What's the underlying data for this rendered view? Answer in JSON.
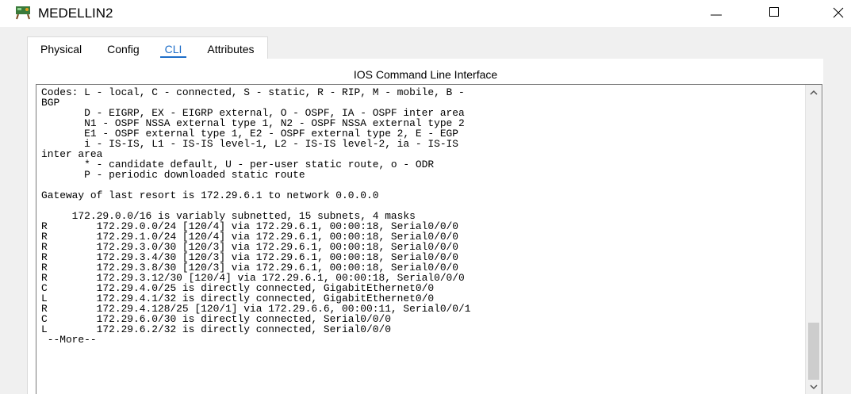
{
  "window": {
    "title": "MEDELLIN2",
    "icon": "router-device-icon",
    "controls": [
      "minimize-icon",
      "maximize-icon",
      "close-icon"
    ]
  },
  "tabs": [
    {
      "label": "Physical",
      "active": false
    },
    {
      "label": "Config",
      "active": false
    },
    {
      "label": "CLI",
      "active": true
    },
    {
      "label": "Attributes",
      "active": false
    }
  ],
  "panel": {
    "title": "IOS Command Line Interface"
  },
  "terminal": {
    "lines": [
      "Codes: L - local, C - connected, S - static, R - RIP, M - mobile, B -",
      "BGP",
      "       D - EIGRP, EX - EIGRP external, O - OSPF, IA - OSPF inter area",
      "       N1 - OSPF NSSA external type 1, N2 - OSPF NSSA external type 2",
      "       E1 - OSPF external type 1, E2 - OSPF external type 2, E - EGP",
      "       i - IS-IS, L1 - IS-IS level-1, L2 - IS-IS level-2, ia - IS-IS",
      "inter area",
      "       * - candidate default, U - per-user static route, o - ODR",
      "       P - periodic downloaded static route",
      "",
      "Gateway of last resort is 172.29.6.1 to network 0.0.0.0",
      "",
      "     172.29.0.0/16 is variably subnetted, 15 subnets, 4 masks",
      "R        172.29.0.0/24 [120/4] via 172.29.6.1, 00:00:18, Serial0/0/0",
      "R        172.29.1.0/24 [120/4] via 172.29.6.1, 00:00:18, Serial0/0/0",
      "R        172.29.3.0/30 [120/3] via 172.29.6.1, 00:00:18, Serial0/0/0",
      "R        172.29.3.4/30 [120/3] via 172.29.6.1, 00:00:18, Serial0/0/0",
      "R        172.29.3.8/30 [120/3] via 172.29.6.1, 00:00:18, Serial0/0/0",
      "R        172.29.3.12/30 [120/4] via 172.29.6.1, 00:00:18, Serial0/0/0",
      "C        172.29.4.0/25 is directly connected, GigabitEthernet0/0",
      "L        172.29.4.1/32 is directly connected, GigabitEthernet0/0",
      "R        172.29.4.128/25 [120/1] via 172.29.6.6, 00:00:11, Serial0/0/1",
      "C        172.29.6.0/30 is directly connected, Serial0/0/0",
      "L        172.29.6.2/32 is directly connected, Serial0/0/0",
      " --More--"
    ]
  },
  "scrollbar": {
    "up_icon": "chevron-up-icon",
    "down_icon": "chevron-down-icon"
  }
}
